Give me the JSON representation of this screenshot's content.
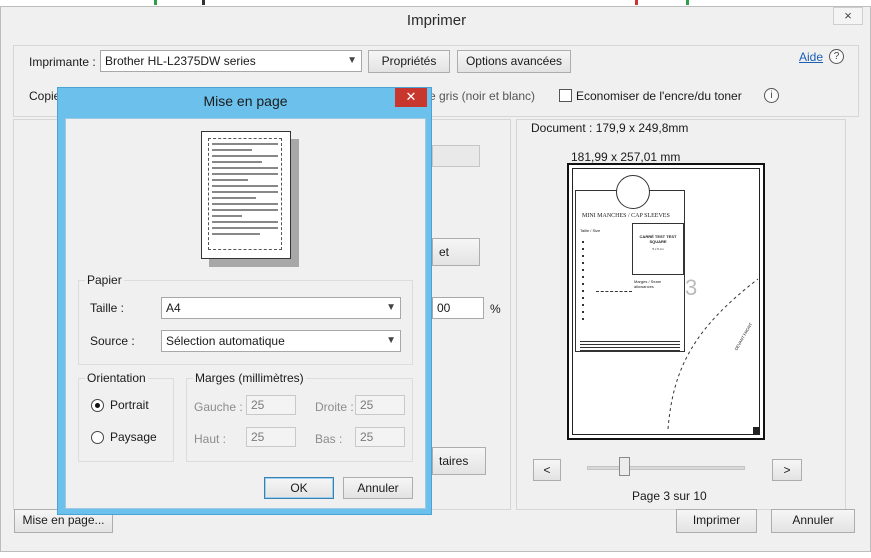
{
  "window": {
    "title": "Imprimer",
    "close": "×"
  },
  "printer": {
    "label": "Imprimante :",
    "selected": "Brother HL-L2375DW series",
    "properties_button": "Propriétés",
    "advanced_button": "Options avancées",
    "help_link": "Aide",
    "help_icon": "?"
  },
  "copies": {
    "label": "Copie"
  },
  "options": {
    "grayscale_label": "e gris (noir et blanc)",
    "save_ink_label": "Economiser de l'encre/du toner",
    "info_icon": "i"
  },
  "partial": {
    "button_et": "et",
    "scale_value": "00",
    "scale_unit": "%",
    "comments_button": "taires"
  },
  "preview": {
    "document_size": "Document : 179,9 x 249,8mm",
    "page_size": "181,99 x 257,01 mm",
    "prev_button": "<",
    "next_button": ">",
    "page_indicator": "Page 3 sur 10",
    "content": {
      "heading": "MINI MANCHES / CAP SLEEVES",
      "size_label": "Taille / Size",
      "box_text": "CARRÉ TEST TEST SQUARE",
      "box_sub": "5 x 5 cm",
      "margin_label": "Marges / Seam allowances",
      "side_note": "DEVANT FRONT",
      "page_corner": "3"
    }
  },
  "bottom": {
    "page_setup_button": "Mise en page...",
    "print_button": "Imprimer",
    "cancel_button": "Annuler"
  },
  "page_setup_dialog": {
    "title": "Mise en page",
    "close": "✕",
    "paper_group": "Papier",
    "size_label": "Taille :",
    "size_value": "A4",
    "source_label": "Source :",
    "source_value": "Sélection automatique",
    "orientation_group": "Orientation",
    "portrait": "Portrait",
    "landscape": "Paysage",
    "margins_group": "Marges (millimètres)",
    "left_label": "Gauche :",
    "left_value": "25",
    "right_label": "Droite :",
    "right_value": "25",
    "top_label": "Haut :",
    "top_value": "25",
    "bottom_label": "Bas :",
    "bottom_value": "25",
    "ok_button": "OK",
    "cancel_button": "Annuler"
  },
  "colors": {
    "dialog_title_bar": "#6cc1ec",
    "close_red": "#c8372d",
    "link": "#1a5fb4"
  }
}
